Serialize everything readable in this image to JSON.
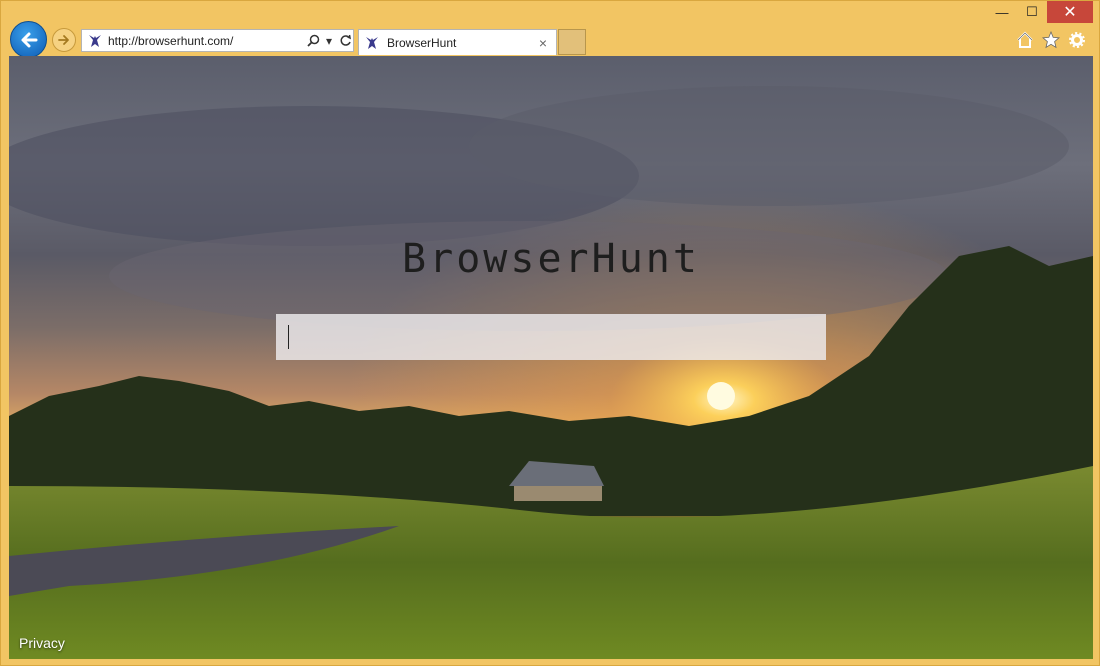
{
  "browser": {
    "url": "http://browserhunt.com/",
    "tab_title": "BrowserHunt",
    "tab_close": "×",
    "window": {
      "minimize": "—",
      "maximize": "☐",
      "close": "✕"
    }
  },
  "page": {
    "brand": "BrowserHunt",
    "search": {
      "value": "",
      "placeholder": ""
    },
    "footer_link": "Privacy"
  },
  "colors": {
    "frame": "#f2c563",
    "back_button": "#1a6fc4",
    "close_button": "#c7473a"
  },
  "icons": [
    "back-arrow-icon",
    "forward-arrow-icon",
    "site-favicon",
    "search-icon",
    "dropdown-icon",
    "refresh-icon",
    "home-icon",
    "favorites-star-icon",
    "settings-gear-icon"
  ]
}
